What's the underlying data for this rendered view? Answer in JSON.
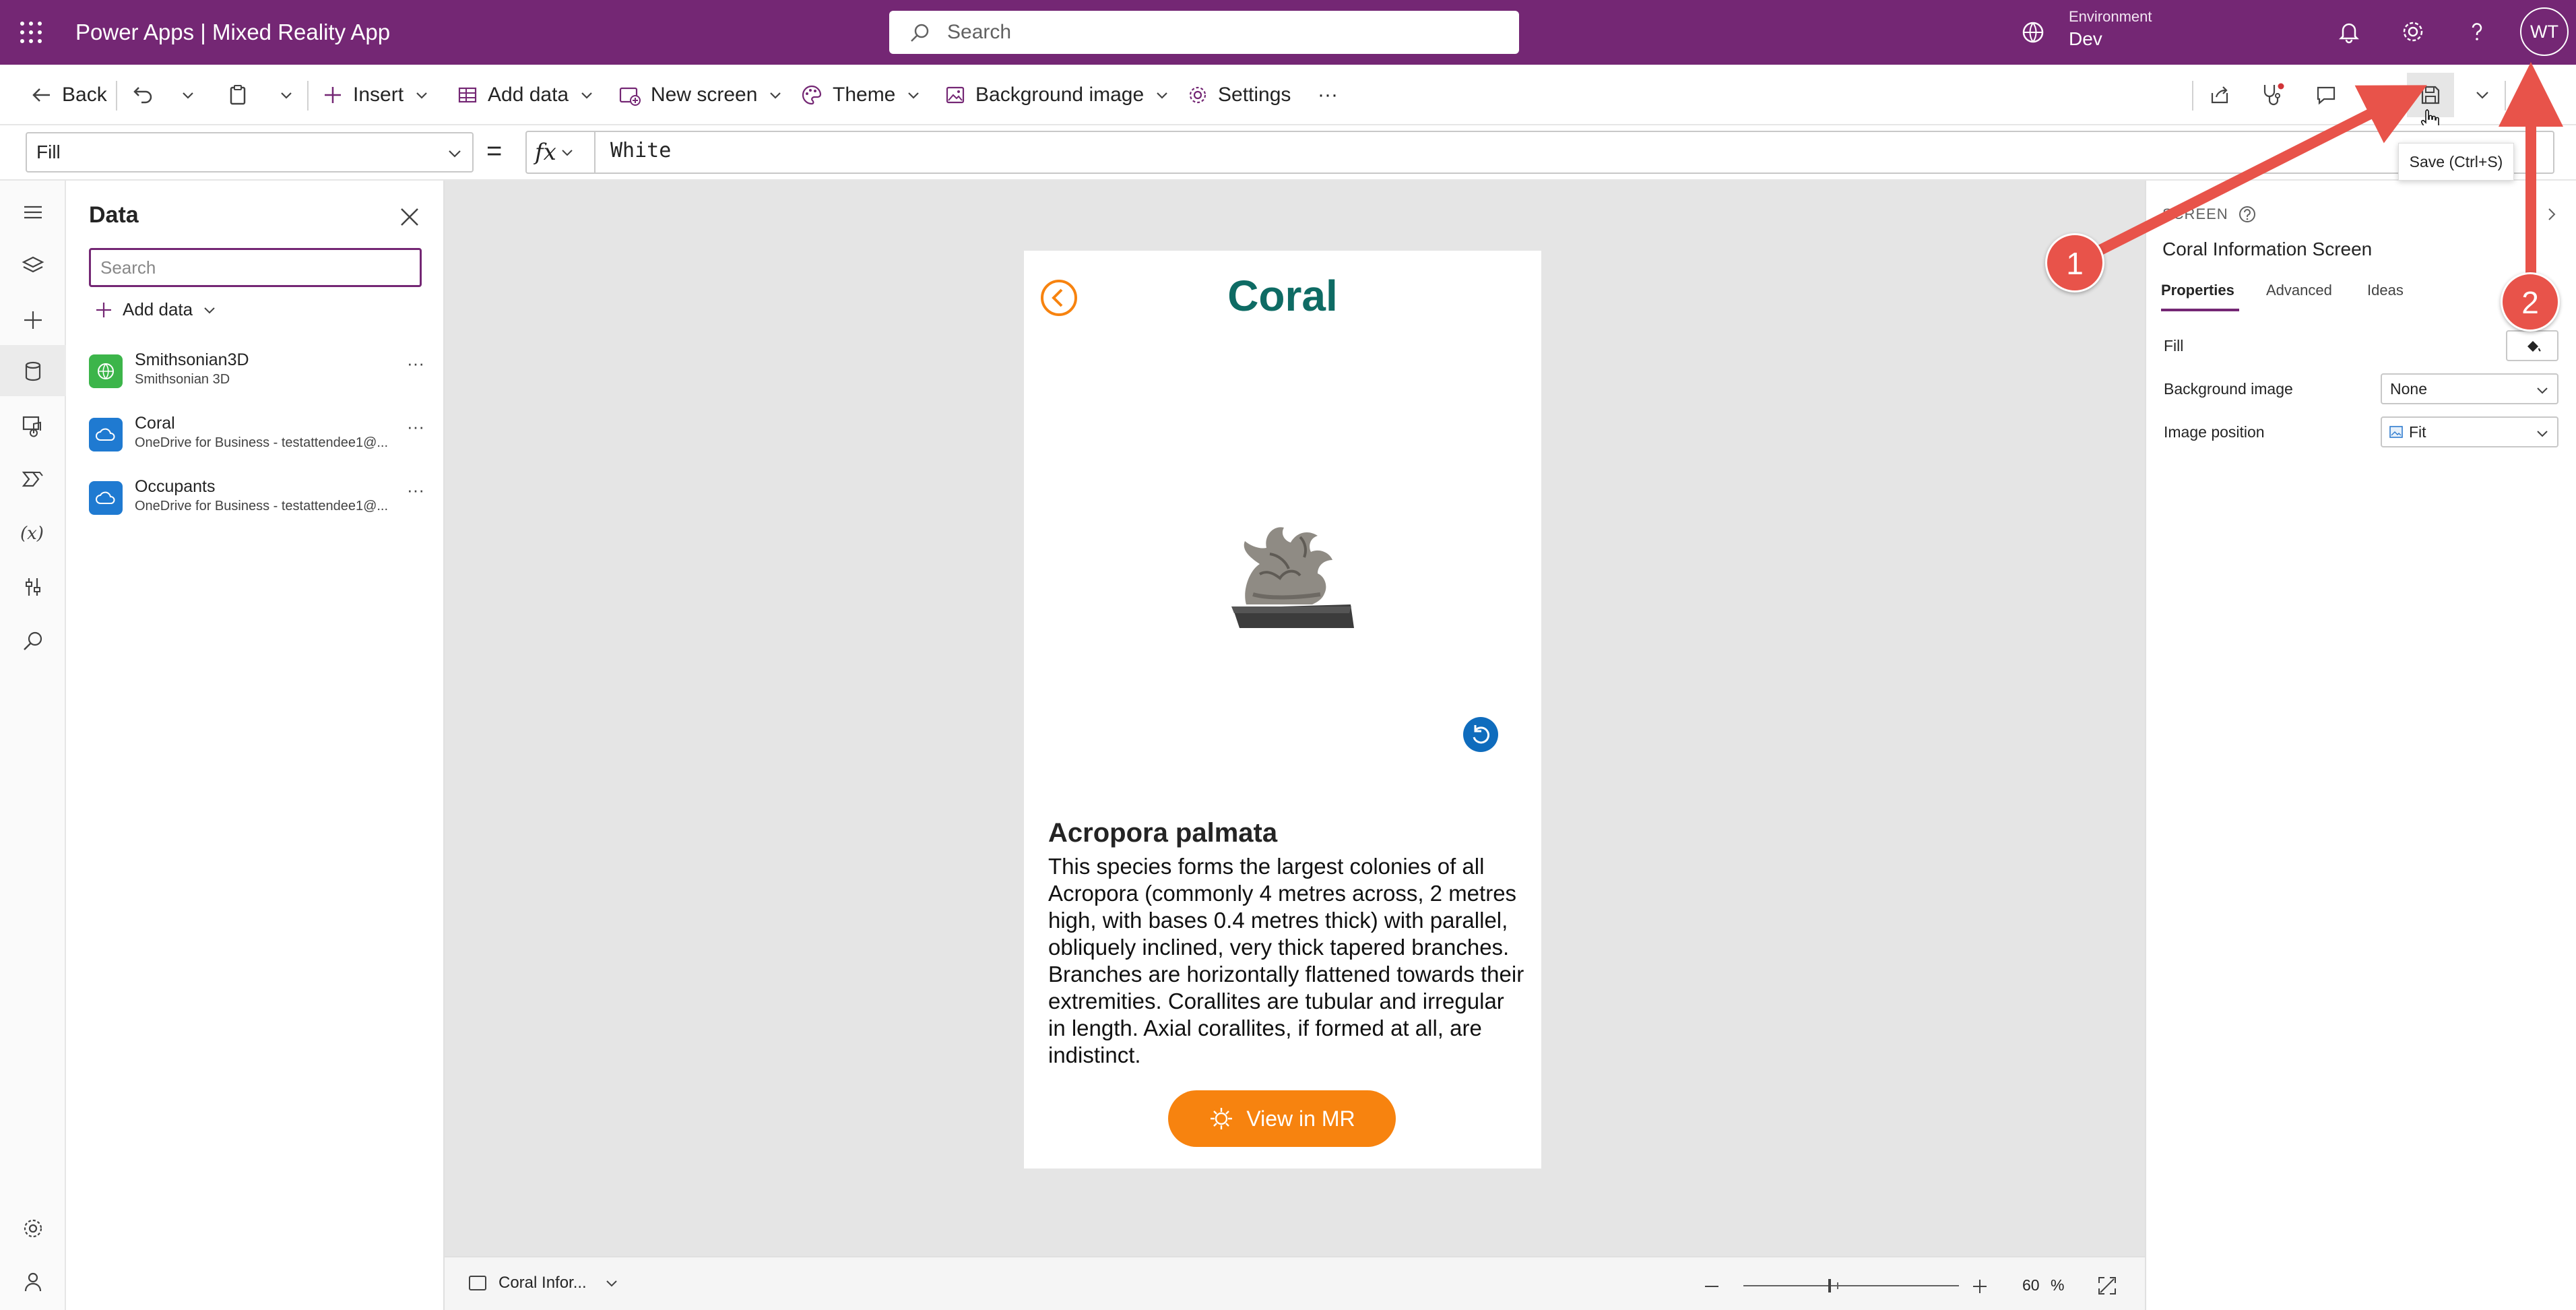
{
  "topbar": {
    "app_title": "Power Apps  |  Mixed Reality App",
    "search_placeholder": "Search",
    "environment_label": "Environment",
    "environment_value": "Dev",
    "avatar_initials": "WT"
  },
  "commandbar": {
    "back": "Back",
    "insert": "Insert",
    "add_data": "Add data",
    "new_screen": "New screen",
    "theme": "Theme",
    "background_image": "Background image",
    "settings": "Settings",
    "more": "···"
  },
  "formulabar": {
    "property": "Fill",
    "equals": "=",
    "fx": "fx",
    "formula": "White"
  },
  "data_panel": {
    "title": "Data",
    "search_placeholder": "Search",
    "add_data": "Add data",
    "sources": [
      {
        "name": "Smithsonian3D",
        "sub": "Smithsonian 3D"
      },
      {
        "name": "Coral",
        "sub": "OneDrive for Business - testattendee1@..."
      },
      {
        "name": "Occupants",
        "sub": "OneDrive for Business - testattendee1@..."
      }
    ],
    "more": "···"
  },
  "app_screen": {
    "title": "Coral",
    "species": "Acropora palmata",
    "description": "This species forms the largest colonies of all Acropora (commonly 4 metres across, 2 metres high, with bases 0.4 metres thick) with parallel, obliquely inclined, very thick tapered branches. Branches are horizontally flattened towards their extremities. Corallites are tubular and irregular in length. Axial corallites, if formed at all, are indistinct.",
    "view_button": "View in MR"
  },
  "bottombar": {
    "screen_name": "Coral Infor...",
    "zoom_value": "60",
    "zoom_unit": "%"
  },
  "right_panel": {
    "type_label": "SCREEN",
    "screen_name": "Coral Information Screen",
    "tabs": [
      "Properties",
      "Advanced",
      "Ideas"
    ],
    "fill_label": "Fill",
    "background_image_label": "Background image",
    "background_image_value": "None",
    "image_position_label": "Image position",
    "image_position_value": "Fit"
  },
  "tooltip": "Save (Ctrl+S)",
  "annotations": [
    "1",
    "2"
  ],
  "colors": {
    "brand": "#742774",
    "title_teal": "#0e6b64",
    "button_orange": "#f7830f",
    "annotation_red": "#e8534a"
  }
}
